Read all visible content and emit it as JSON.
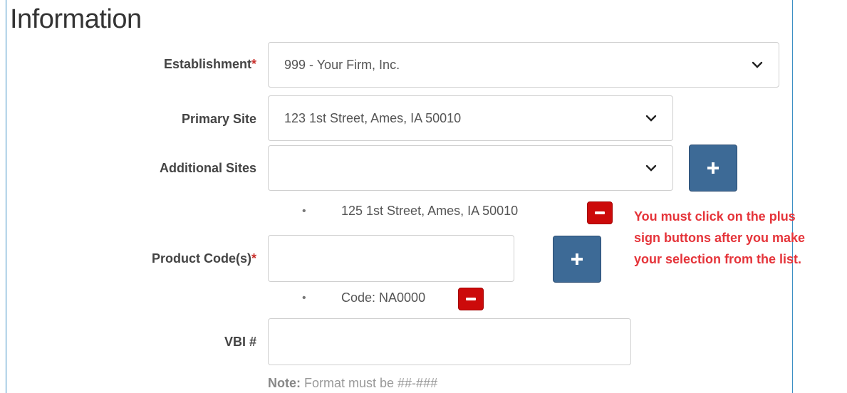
{
  "section": {
    "title": "Information"
  },
  "fields": {
    "establishment": {
      "label": "Establishment",
      "required_mark": "*",
      "value": "999 - Your Firm, Inc."
    },
    "primary_site": {
      "label": "Primary Site",
      "value": "123 1st Street, Ames, IA 50010"
    },
    "additional_sites": {
      "label": "Additional Sites",
      "value": "",
      "items": [
        {
          "text": "125 1st Street, Ames, IA 50010"
        }
      ]
    },
    "product_codes": {
      "label": "Product Code(s)",
      "required_mark": "*",
      "value": "",
      "items": [
        {
          "text": "Code: NA0000"
        }
      ]
    },
    "vbi": {
      "label": "VBI #",
      "value": "",
      "note_label": "Note:",
      "note_text": " Format must be ##-###"
    }
  },
  "bullet_char": "•",
  "annotation": {
    "lines": [
      "You must click on the plus",
      "sign buttons after you make",
      "your selection from the list."
    ]
  },
  "colors": {
    "accent_blue": "#3d6a96",
    "remove_red": "#cc0a0a",
    "annotation_red": "#e5343a",
    "frame_line": "#3b8fc4"
  },
  "icons": {
    "dropdown": "chevron-down-icon",
    "add": "plus-icon",
    "remove": "minus-icon"
  }
}
